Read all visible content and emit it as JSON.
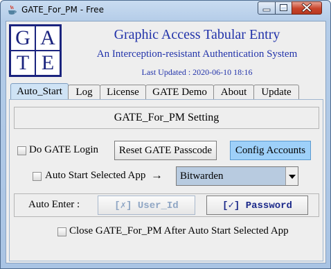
{
  "window": {
    "title": "GATE_For_PM - Free",
    "app_icon": "java-cup-icon"
  },
  "header": {
    "logo_letters": [
      "G",
      "A",
      "T",
      "E"
    ],
    "title": "Graphic Access Tabular Entry",
    "subtitle": "An Interception-resistant Authentication System",
    "last_updated": "Last Updated : 2020-06-10 18:16"
  },
  "tabs": [
    {
      "label": "Auto_Start",
      "active": true
    },
    {
      "label": "Log",
      "active": false
    },
    {
      "label": "License",
      "active": false
    },
    {
      "label": "GATE Demo",
      "active": false
    },
    {
      "label": "About",
      "active": false
    },
    {
      "label": "Update",
      "active": false
    }
  ],
  "auto_start": {
    "setting_title": "GATE_For_PM  Setting",
    "do_gate_login_label": "Do GATE Login",
    "reset_passcode_label": "Reset GATE Passcode",
    "config_accounts_label": "Config Accounts",
    "auto_start_app_label": "Auto Start Selected App",
    "arrow": "→",
    "selected_app": "Bitwarden",
    "auto_enter_label": "Auto Enter   :",
    "user_id_button": "[✗] User_Id",
    "password_button": "[✓] Password",
    "close_after_label": "Close GATE_For_PM After Auto Start Selected App"
  },
  "colors": {
    "accent_text": "#2233aa",
    "config_button": "#9ed0f9",
    "active_tab": "#cfe3f5",
    "close_button": "#c8442a"
  }
}
